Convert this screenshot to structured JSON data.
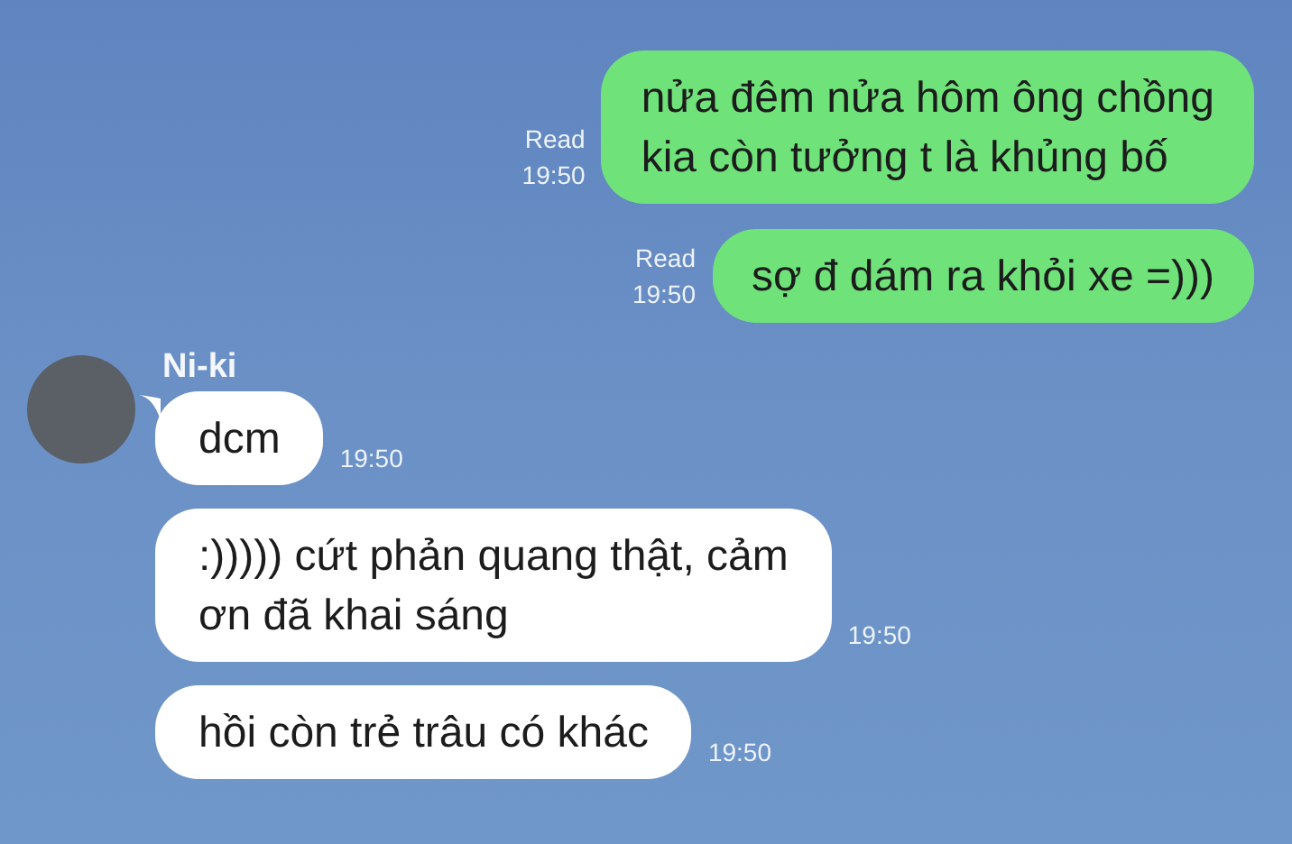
{
  "messages": [
    {
      "kind": "sent",
      "lines": [
        "nửa đêm nửa hôm ông chồng",
        "kia còn tưởng t là khủng bố"
      ],
      "status": "Read",
      "time": "19:50",
      "tail": false
    },
    {
      "kind": "sent",
      "lines": [
        "sợ đ dám ra khỏi xe =)))"
      ],
      "status": "Read",
      "time": "19:50",
      "tail": false
    },
    {
      "kind": "received",
      "sender": "Ni-ki",
      "lines": [
        "dcm"
      ],
      "time": "19:50",
      "tail": true
    },
    {
      "kind": "received",
      "lines": [
        ":))))) cứt phản quang thật, cảm",
        "ơn đã khai sáng"
      ],
      "time": "19:50",
      "tail": false
    },
    {
      "kind": "received",
      "lines": [
        "hồi còn trẻ trâu có khác"
      ],
      "time": "19:50",
      "tail": false
    }
  ]
}
